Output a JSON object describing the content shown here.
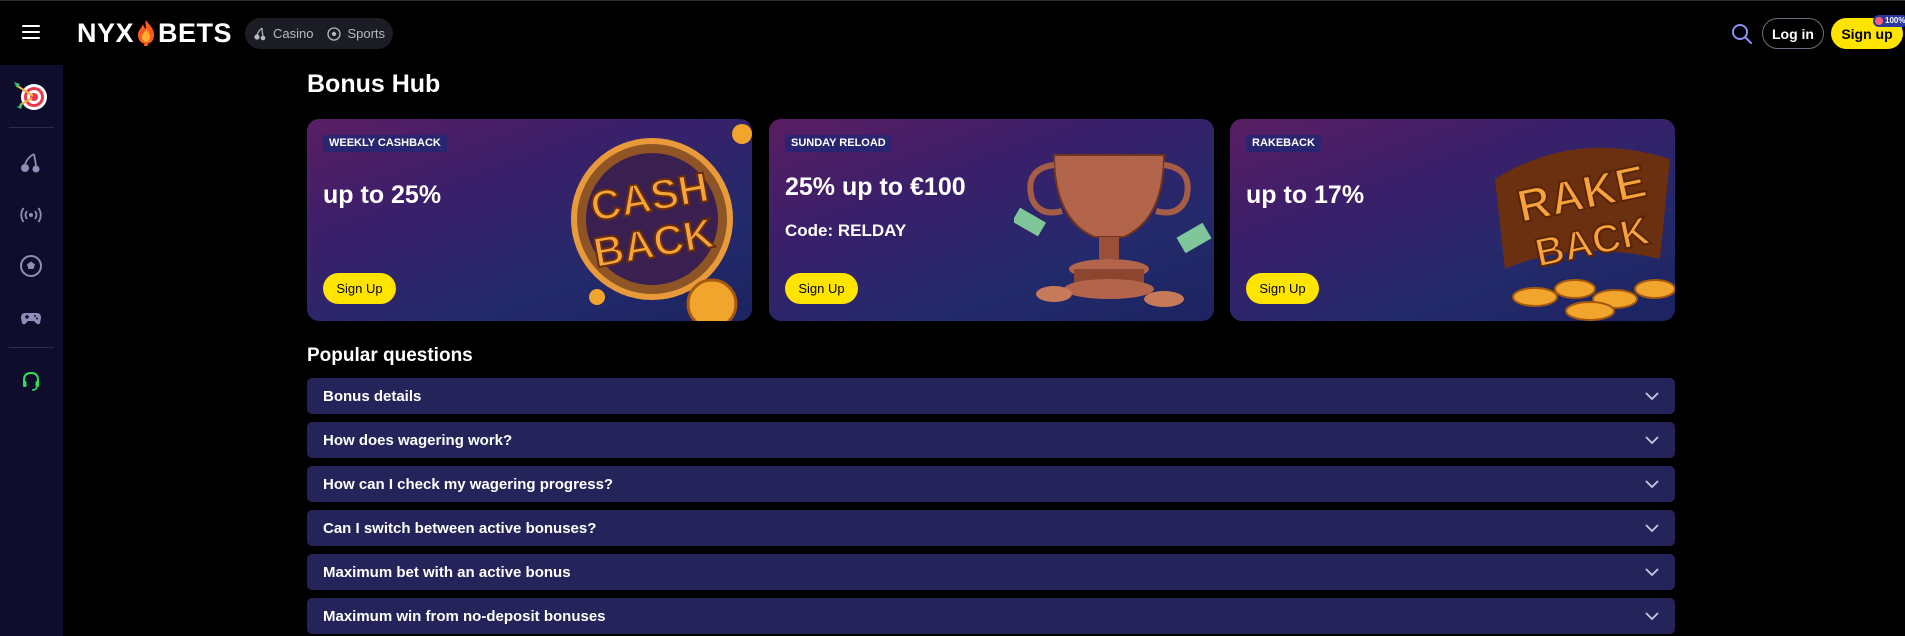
{
  "header": {
    "brand": {
      "left": "NYX",
      "right": "BETS"
    },
    "nav": [
      {
        "label": "Casino",
        "icon": "cherries-icon"
      },
      {
        "label": "Sports",
        "icon": "soccer-ball-icon"
      }
    ],
    "login_label": "Log in",
    "signup_label": "Sign up",
    "badge": "100%"
  },
  "sidebar": {
    "items": [
      {
        "icon": "target-darts-icon"
      },
      {
        "icon": "cherries-icon"
      },
      {
        "icon": "live-broadcast-icon"
      },
      {
        "icon": "soccer-ball-icon"
      },
      {
        "icon": "gamepad-icon"
      },
      {
        "icon": "headset-support-icon"
      }
    ]
  },
  "main": {
    "title": "Bonus Hub",
    "cards": [
      {
        "tag": "WEEKLY CASHBACK",
        "amount": "up to 25%",
        "code": "",
        "button": "Sign Up",
        "art": "CASH BACK"
      },
      {
        "tag": "SUNDAY RELOAD",
        "amount": "25% up to €100",
        "code": "Code: RELDAY",
        "button": "Sign Up",
        "art": "trophy"
      },
      {
        "tag": "RAKEBACK",
        "amount": "up to 17%",
        "code": "",
        "button": "Sign Up",
        "art": "RAKE BACK"
      }
    ],
    "faq_title": "Popular questions",
    "faq": [
      "Bonus details",
      "How does wagering work?",
      "How can I check my wagering progress?",
      "Can I switch between active bonuses?",
      "Maximum bet with an active bonus",
      "Maximum win from no-deposit bonuses"
    ]
  },
  "colors": {
    "accent": "#ffe400",
    "sidebar_bg": "#0e0d2c",
    "faq_bg": "#24245a",
    "support_green": "#2fe05a"
  }
}
